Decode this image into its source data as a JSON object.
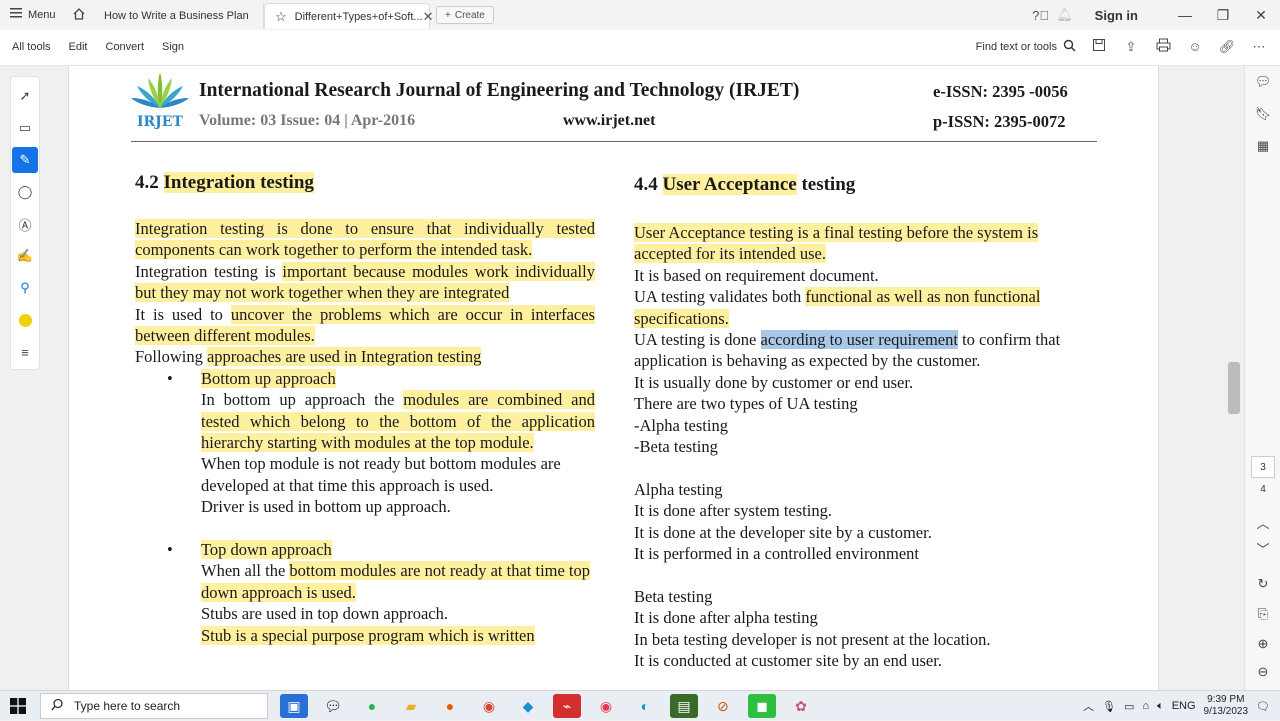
{
  "tabbar": {
    "menu_label": "Menu",
    "tabs": [
      {
        "label": "How to Write a Business Plan"
      },
      {
        "label": "Different+Types+of+Soft..."
      }
    ],
    "create_label": "Create",
    "signin_label": "Sign in"
  },
  "toolbar": {
    "items": [
      "All tools",
      "Edit",
      "Convert",
      "Sign"
    ],
    "find_label": "Find text or tools"
  },
  "document": {
    "header": {
      "logo_text": "IRJET",
      "journal_title": "International Research Journal of Engineering and Technology (IRJET)",
      "eissn": "e-ISSN: 2395 -0056",
      "volume": "Volume: 03 Issue: 04 | Apr-2016",
      "website": "www.irjet.net",
      "pissn": "p-ISSN: 2395-0072"
    },
    "left": {
      "heading_num": "4.2",
      "heading_text": "Integration testing",
      "p1": "Integration testing is done to ensure that individually tested components can work together to perform the intended task.",
      "p2a": "Integration testing is ",
      "p2b": "important because modules work individually but they may not work together when they are integrated",
      "p3a": "It is used to ",
      "p3b": "uncover the problems which are occur in interfaces between different modules.",
      "p4a": "Following ",
      "p4b": "approaches are used in Integration testing",
      "bullet1_title": "Bottom up approach",
      "b1a": "In bottom up approach the ",
      "b1b": "modules are combined and tested which belong to the bottom of the application hierarchy starting with modules at the top module.",
      "b1c": "When top module is not ready but bottom modules are developed at that time this approach is used.",
      "b1d": "Driver is used in bottom up approach.",
      "bullet2_title": "Top down approach",
      "b2a": "When all the ",
      "b2b": "bottom modules are not ready at that time top down approach is used.",
      "b2c": "Stubs are used in top down approach.",
      "b2d": "Stub is a special purpose program which is written"
    },
    "right": {
      "heading_num": "4.4",
      "heading_hl": "User Acceptance",
      "heading_rest": " testing",
      "p1": "User Acceptance testing is a final testing before the system is accepted for its intended use.",
      "p2": "It is based on requirement document.",
      "p3a": "UA testing validates both ",
      "p3b": "functional as well as non functional specifications.",
      "p4a": "UA testing is done ",
      "p4sel": "according to user requirement",
      "p4b": " to confirm that application is behaving as expected by the customer.",
      "p5": "It is usually done by customer or end user.",
      "p6": "There are two types of UA testing",
      "p7": "-Alpha testing",
      "p8": "-Beta testing",
      "alpha_title": "Alpha testing",
      "a1": "It is done after system testing.",
      "a2": "It is done at the developer site by a customer.",
      "a3": "It is performed in a controlled environment",
      "beta_title": "Beta testing",
      "bt1": "It is done after alpha testing",
      "bt2": "In beta testing developer is not present at the location.",
      "bt3": "It is conducted at customer site by an end user."
    }
  },
  "pager": {
    "current": "3",
    "next": "4"
  },
  "taskbar": {
    "search_placeholder": "Type here to search",
    "lang": "ENG",
    "time": "9:39 PM",
    "date": "9/13/2023"
  }
}
